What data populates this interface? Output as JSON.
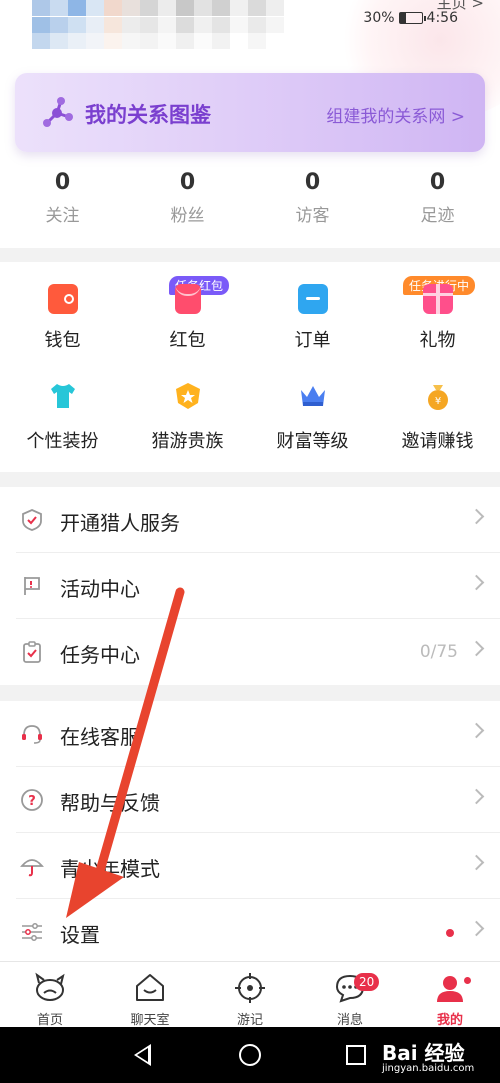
{
  "status_bar": {
    "battery": "30%",
    "time": "4:56"
  },
  "header": {
    "homepage_link": "主页 >"
  },
  "relation_banner": {
    "title": "我的关系图鉴",
    "link": "组建我的关系网 >"
  },
  "stats": [
    {
      "value": "0",
      "label": "关注"
    },
    {
      "value": "0",
      "label": "粉丝"
    },
    {
      "value": "0",
      "label": "访客"
    },
    {
      "value": "0",
      "label": "足迹"
    }
  ],
  "grid": [
    {
      "label": "钱包",
      "icon": "wallet-icon",
      "color": "#ff5a3c"
    },
    {
      "label": "红包",
      "icon": "red-envelope-icon",
      "color": "#ff4d6d",
      "tag": "任务红包",
      "tag_color": "#7a5af8"
    },
    {
      "label": "订单",
      "icon": "order-icon",
      "color": "#2fa6f0"
    },
    {
      "label": "礼物",
      "icon": "gift-icon",
      "color": "#ff4f8b",
      "tag": "任务进行中",
      "tag_color": "#ff8a2b"
    },
    {
      "label": "个性装扮",
      "icon": "tshirt-icon",
      "color": "#27c6d8"
    },
    {
      "label": "猎游贵族",
      "icon": "badge-icon",
      "color": "#ffb21e"
    },
    {
      "label": "财富等级",
      "icon": "crown-icon",
      "color": "#4a7ef0"
    },
    {
      "label": "邀请赚钱",
      "icon": "money-bag-icon",
      "color": "#f5a623"
    }
  ],
  "menu_group1": [
    {
      "label": "开通猎人服务",
      "icon": "shield-check-icon"
    },
    {
      "label": "活动中心",
      "icon": "flag-icon"
    },
    {
      "label": "任务中心",
      "icon": "clipboard-icon",
      "value": "0/75"
    }
  ],
  "menu_group2": [
    {
      "label": "在线客服",
      "icon": "headset-icon"
    },
    {
      "label": "帮助与反馈",
      "icon": "question-icon"
    },
    {
      "label": "青少年模式",
      "icon": "umbrella-icon"
    },
    {
      "label": "设置",
      "icon": "settings-icon"
    }
  ],
  "tabbar": [
    {
      "label": "首页",
      "icon": "home-creature-icon"
    },
    {
      "label": "聊天室",
      "icon": "chat-house-icon"
    },
    {
      "label": "游记",
      "icon": "target-icon"
    },
    {
      "label": "消息",
      "icon": "message-icon",
      "badge": "20"
    },
    {
      "label": "我的",
      "icon": "profile-icon",
      "active": true
    }
  ],
  "watermark": {
    "main": "Bai 经验",
    "sub": "jingyan.baidu.com"
  },
  "colors": {
    "accent": "#e8304a",
    "banner_purple": "#7a3fcf"
  }
}
